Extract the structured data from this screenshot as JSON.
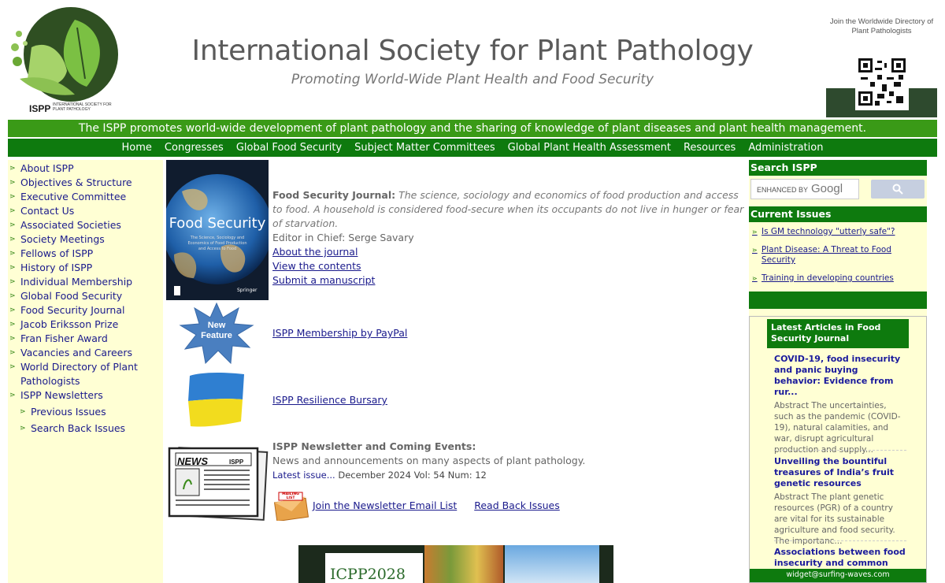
{
  "header": {
    "logo_abbr": "ISPP",
    "logo_fullname": "INTERNATIONAL SOCIETY FOR PLANT PATHOLOGY",
    "title": "International Society for Plant Pathology",
    "tagline": "Promoting World-Wide Plant Health and Food Security",
    "qr_caption": "Join the Worldwide Directory of Plant Pathologists"
  },
  "banner": "The ISPP promotes world-wide development of plant pathology and the sharing of knowledge of plant diseases and plant health management.",
  "nav": [
    "Home",
    "Congresses",
    "Global Food Security",
    "Subject Matter Committees",
    "Global Plant Health Assessment",
    "Resources",
    "Administration"
  ],
  "sidebar": {
    "items": [
      "About ISPP",
      "Objectives & Structure",
      "Executive Committee",
      "Contact Us",
      "Associated Societies",
      "Society Meetings",
      "Fellows of ISPP",
      "History of ISPP",
      "Individual Membership",
      "Global Food Security",
      "Food Security Journal",
      "Jacob Eriksson Prize",
      "Fran Fisher Award",
      "Vacancies and Careers",
      "World Directory of Plant Pathologists",
      "ISPP Newsletters"
    ],
    "sub_items": [
      "Previous Issues",
      "Search Back Issues"
    ]
  },
  "journal": {
    "cover_title": "Food Security",
    "cover_subtitle": "The Science, Sociology and Economics of Food Production and Access to Food",
    "cover_publisher": "Springer",
    "label": "Food Security Journal:",
    "desc": "The science, sociology and economics of food production and access to food. A household is considered food-secure when its occupants do not live in hunger or fear of starvation.",
    "editor": "Editor in Chief: Serge Savary",
    "links": [
      "About the journal",
      "View the contents",
      "Submit a manuscript"
    ]
  },
  "membership": {
    "badge_line1": "New",
    "badge_line2": "Feature",
    "link": "ISPP Membership by PayPal"
  },
  "bursary": {
    "link": "ISPP Resilience Bursary"
  },
  "newsletter": {
    "title": "ISPP Newsletter and Coming Events:",
    "desc": "News and announcements on many aspects of plant pathology.",
    "latest_label": "Latest issue...",
    "latest_info": "December  2024  Vol: 54  Num: 12",
    "image_text": "NEWS",
    "image_brand": "ISPP",
    "mailing_badge": "MAILING LIST",
    "join_link": "Join the Newsletter Email List",
    "back_link": "Read Back Issues"
  },
  "congress_banner": "ICPP2028",
  "right": {
    "search_heading": "Search ISPP",
    "search_enhanced": "ENHANCED BY",
    "search_google": "Googl",
    "issues_heading": "Current Issues",
    "issues": [
      "Is GM technology \"utterly safe\"?",
      "Plant Disease: A Threat to Food Security",
      "Training in developing countries"
    ],
    "widget_heading": "Latest Articles in Food Security Journal",
    "articles": [
      {
        "title": "COVID-19, food insecurity and panic buying behavior: Evidence from rur...",
        "abstract": "Abstract The uncertainties, such as the pandemic (COVID-19), natural calamities, and war, disrupt agricultural production and supply..."
      },
      {
        "title": "Unveiling the bountiful treasures of India’s fruit genetic resources",
        "abstract": "Abstract The plant genetic resources (PGR) of a country are vital for its sustainable agriculture and food security. The importanc..."
      },
      {
        "title": "Associations between food insecurity and common mental",
        "abstract": ""
      }
    ],
    "widget_footer": "widget@surfing-waves.com"
  },
  "colors": {
    "green_dark": "#0e7a0e",
    "green_banner": "#3a9a17",
    "sidebar_bg": "#ffffd4",
    "link": "#1a1a8c"
  }
}
